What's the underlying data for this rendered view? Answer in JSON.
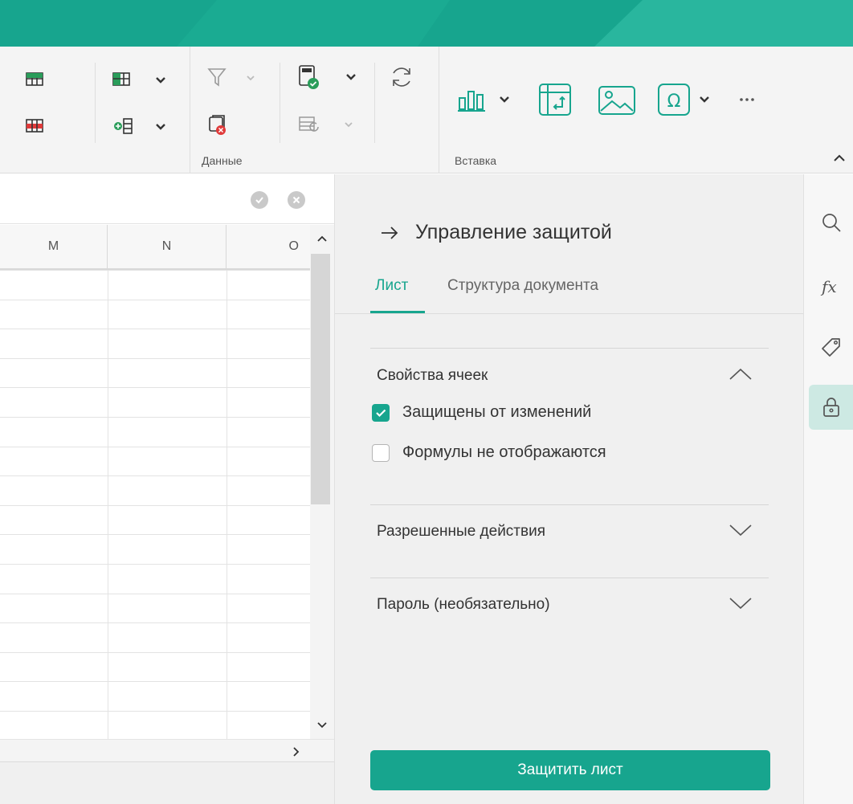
{
  "colors": {
    "accent": "#17a58e",
    "accent_light": "#cde9e3"
  },
  "ribbon": {
    "groups": [
      {
        "label": "Данные"
      },
      {
        "label": "Вставка"
      }
    ],
    "icons": [
      "insert-rows-icon",
      "delete-rows-icon",
      "insert-cells-icon",
      "insert-columns-icon",
      "filter-icon",
      "clear-filter-icon",
      "calculate-icon",
      "conditional-format-icon",
      "refresh-icon",
      "chart-icon",
      "pivot-table-icon",
      "image-icon",
      "special-symbol-icon",
      "more-icon"
    ]
  },
  "grid": {
    "columns": [
      "M",
      "N",
      "O"
    ]
  },
  "panel": {
    "title": "Управление защитой",
    "tabs": [
      {
        "label": "Лист",
        "active": true
      },
      {
        "label": "Структура документа",
        "active": false
      }
    ],
    "sections": {
      "cell_props": {
        "title": "Свойства ячеек",
        "expanded": true,
        "options": [
          {
            "label": "Защищены от изменений",
            "checked": true
          },
          {
            "label": "Формулы не отображаются",
            "checked": false
          }
        ]
      },
      "allowed_actions": {
        "title": "Разрешенные действия",
        "expanded": false
      },
      "password": {
        "title": "Пароль (необязательно)",
        "expanded": false
      }
    },
    "protect_button": "Защитить лист"
  },
  "rail": {
    "icons": [
      "search-icon",
      "function-icon",
      "tag-icon",
      "lock-icon"
    ],
    "active": "lock-icon"
  }
}
